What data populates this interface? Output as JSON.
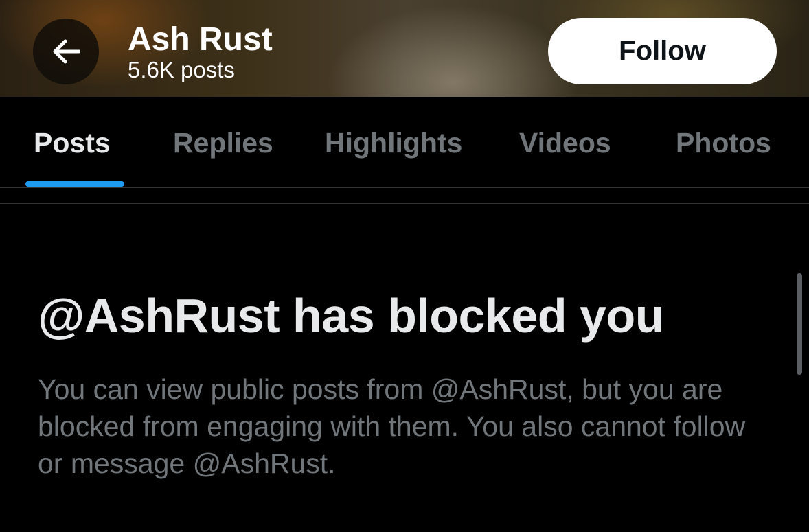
{
  "header": {
    "back_icon": "arrow-left-icon",
    "name": "Ash Rust",
    "post_count": "5.6K posts",
    "follow_label": "Follow"
  },
  "tabs": [
    {
      "label": "Posts",
      "active": true
    },
    {
      "label": "Replies",
      "active": false
    },
    {
      "label": "Highlights",
      "active": false
    },
    {
      "label": "Videos",
      "active": false
    },
    {
      "label": "Photos",
      "active": false
    }
  ],
  "blocked": {
    "title": "@AshRust has blocked you",
    "description": "You can view public posts from @AshRust, but you are blocked from engaging with them. You also cannot follow or message @AshRust."
  },
  "colors": {
    "accent": "#1d9bf0",
    "background": "#000000",
    "primary_text": "#e7e9ea",
    "secondary_text": "#71767b"
  }
}
